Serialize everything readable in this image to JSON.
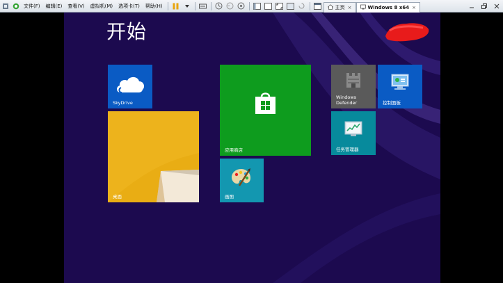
{
  "toolbar": {
    "menus": [
      "文件(F)",
      "编辑(E)",
      "查看(V)",
      "虚拟机(M)",
      "选项卡(T)",
      "帮助(H)"
    ],
    "tabs": [
      {
        "label": "主页",
        "close": "×"
      },
      {
        "label": "Windows 8 x64",
        "close": "×"
      }
    ]
  },
  "start": {
    "title": "开始"
  },
  "tiles": [
    {
      "label": "SkyDrive",
      "color": "#0a5bc4"
    },
    {
      "label": "桌面",
      "color": "#e8a90f"
    },
    {
      "label": "应用商店",
      "color": "#0e9c1e"
    },
    {
      "label": "画图",
      "color": "#1397b0"
    },
    {
      "label": "Windows Defender",
      "color": "#5a5a5a"
    },
    {
      "label": "控制面板",
      "color": "#0a5bc4"
    },
    {
      "label": "任务管理器",
      "color": "#078a9c"
    }
  ],
  "colors": {
    "start_background": "#1c0a4f",
    "accent_red": "#e81b1b"
  },
  "icons": [
    "skydrive-cloud-icon",
    "store-bag-icon",
    "paint-palette-icon",
    "defender-castle-icon",
    "control-panel-icon",
    "task-manager-icon"
  ]
}
